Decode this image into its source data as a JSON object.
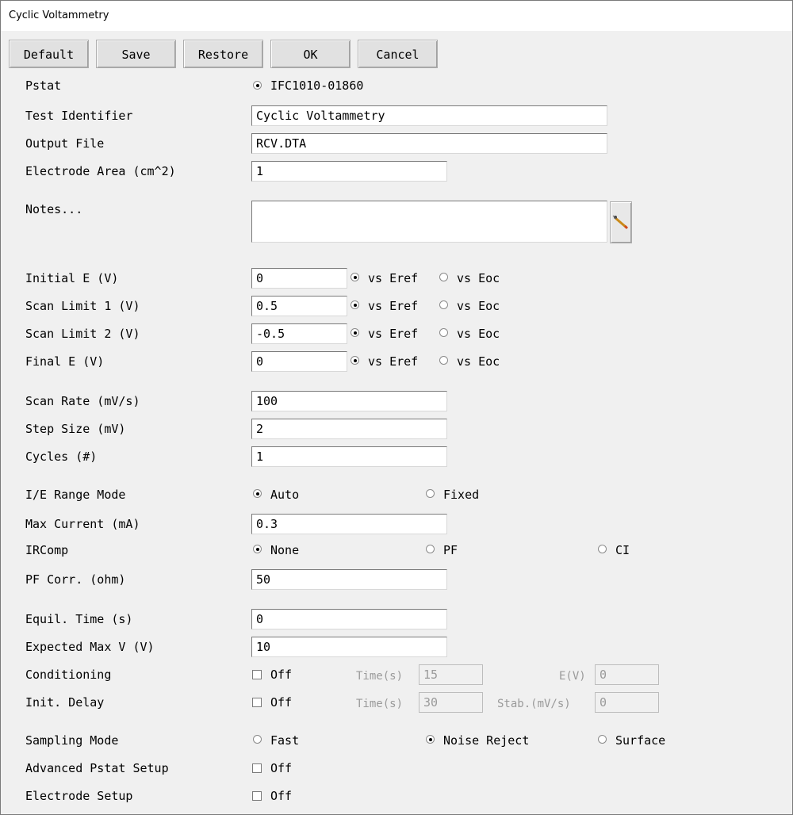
{
  "window": {
    "title": "Cyclic Voltammetry"
  },
  "toolbar": {
    "default": "Default",
    "save": "Save",
    "restore": "Restore",
    "ok": "OK",
    "cancel": "Cancel"
  },
  "pstat": {
    "label": "Pstat",
    "value": "IFC1010-01860"
  },
  "test_identifier": {
    "label": "Test Identifier",
    "value": "Cyclic Voltammetry"
  },
  "output_file": {
    "label": "Output File",
    "value": "RCV.DTA"
  },
  "electrode_area": {
    "label": "Electrode Area (cm^2)",
    "value": "1"
  },
  "notes": {
    "label": "Notes...",
    "value": "",
    "icon": "pencil-icon"
  },
  "ref_options": {
    "eref": "vs Eref",
    "eoc": "vs Eoc"
  },
  "potentials": [
    {
      "label": "Initial E (V)",
      "value": "0",
      "selected": "eref"
    },
    {
      "label": "Scan Limit 1 (V)",
      "value": "0.5",
      "selected": "eref"
    },
    {
      "label": "Scan Limit 2 (V)",
      "value": "-0.5",
      "selected": "eref"
    },
    {
      "label": "Final E (V)",
      "value": "0",
      "selected": "eref"
    }
  ],
  "scan_rate": {
    "label": "Scan Rate (mV/s)",
    "value": "100"
  },
  "step_size": {
    "label": "Step Size (mV)",
    "value": "2"
  },
  "cycles": {
    "label": "Cycles (#)",
    "value": "1"
  },
  "ie_range_mode": {
    "label": "I/E Range Mode",
    "options": [
      "Auto",
      "Fixed"
    ],
    "selected": "Auto"
  },
  "max_current": {
    "label": "Max Current (mA)",
    "value": "0.3"
  },
  "ircomp": {
    "label": "IRComp",
    "options": [
      "None",
      "PF",
      "CI"
    ],
    "selected": "None"
  },
  "pf_corr": {
    "label": "PF Corr. (ohm)",
    "value": "50"
  },
  "equil_time": {
    "label": "Equil. Time (s)",
    "value": "0"
  },
  "expected_max_v": {
    "label": "Expected Max V (V)",
    "value": "10"
  },
  "conditioning": {
    "label": "Conditioning",
    "checkbox": "Off",
    "time_label": "Time(s)",
    "time_value": "15",
    "e_label": "E(V)",
    "e_value": "0"
  },
  "init_delay": {
    "label": "Init. Delay",
    "checkbox": "Off",
    "time_label": "Time(s)",
    "time_value": "30",
    "stab_label": "Stab.(mV/s)",
    "stab_value": "0"
  },
  "sampling_mode": {
    "label": "Sampling Mode",
    "options": [
      "Fast",
      "Noise Reject",
      "Surface"
    ],
    "selected": "Noise Reject"
  },
  "advanced_pstat_setup": {
    "label": "Advanced Pstat Setup",
    "checkbox": "Off"
  },
  "electrode_setup": {
    "label": "Electrode Setup",
    "checkbox": "Off"
  }
}
